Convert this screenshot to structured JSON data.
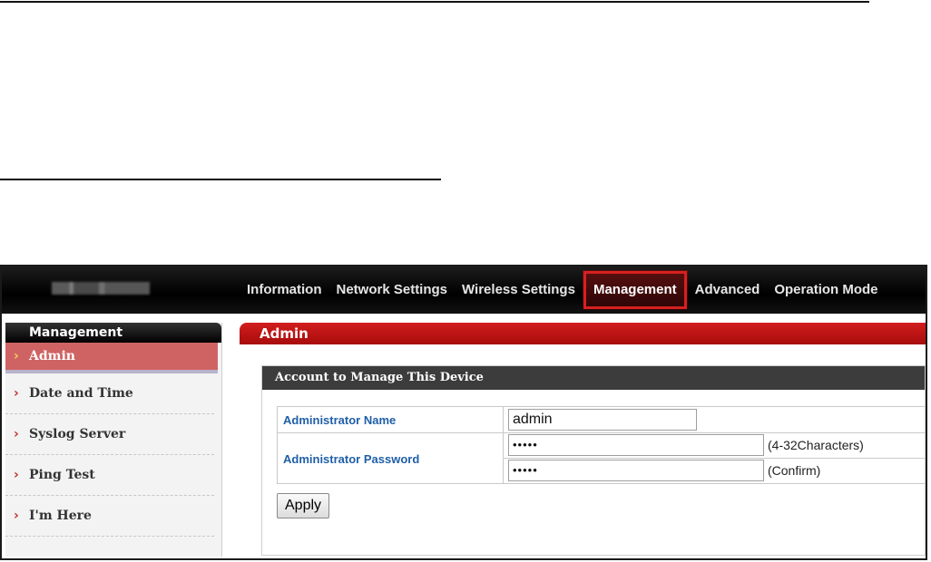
{
  "nav": {
    "items": [
      "Information",
      "Network Settings",
      "Wireless Settings",
      "Management",
      "Advanced",
      "Operation Mode"
    ],
    "active": "Management"
  },
  "sidebar": {
    "title": "Management",
    "items": [
      "Admin",
      "Date and Time",
      "Syslog Server",
      "Ping Test",
      "I'm Here"
    ]
  },
  "main": {
    "title": "Admin",
    "panel_title": "Account to Manage This Device",
    "admin_name_label": "Administrator Name",
    "admin_name_value": "admin",
    "admin_password_label": "Administrator Password",
    "password_value": "•••••",
    "confirm_value": "•••••",
    "password_note": "(4-32Characters)",
    "confirm_note": "(Confirm)",
    "apply_label": "Apply"
  },
  "colors": {
    "accent_red": "#c4141a",
    "label_blue": "#1f5fa8"
  }
}
